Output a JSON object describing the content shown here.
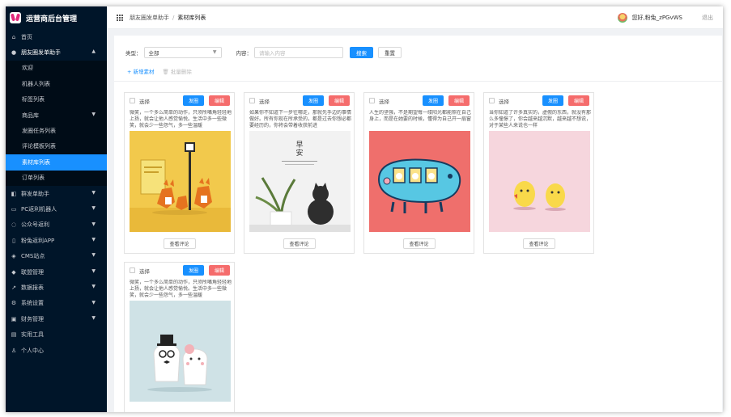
{
  "app": {
    "title": "运营商后台管理"
  },
  "sidebar": {
    "items": [
      {
        "label": "首页",
        "icon": "home-icon"
      },
      {
        "label": "朋友圈发单助手",
        "icon": "circle-icon",
        "open": true,
        "children": [
          {
            "label": "欢迎"
          },
          {
            "label": "机器人列表"
          },
          {
            "label": "标签列表"
          },
          {
            "label": "商品库",
            "has_children": true
          },
          {
            "label": "发圈任务列表"
          },
          {
            "label": "评论模板列表"
          },
          {
            "label": "素材库列表",
            "active": true
          },
          {
            "label": "订单列表"
          }
        ]
      },
      {
        "label": "群发单助手",
        "icon": "group-icon"
      },
      {
        "label": "PC返利机器人",
        "icon": "pc-icon"
      },
      {
        "label": "公众号返利",
        "icon": "wechat-icon"
      },
      {
        "label": "粉兔返利APP",
        "icon": "phone-icon"
      },
      {
        "label": "CMS站点",
        "icon": "cms-icon"
      },
      {
        "label": "联盟管理",
        "icon": "alliance-icon"
      },
      {
        "label": "数据报表",
        "icon": "chart-icon"
      },
      {
        "label": "系统设置",
        "icon": "gear-icon"
      },
      {
        "label": "财务管理",
        "icon": "finance-icon"
      },
      {
        "label": "实用工具",
        "icon": "tool-icon"
      },
      {
        "label": "个人中心",
        "icon": "user-icon"
      }
    ]
  },
  "header": {
    "breadcrumb": [
      "朋友圈发单助手",
      "素材库列表"
    ],
    "greeting": "您好,粉兔_zPGvWS",
    "logout": "退出"
  },
  "filter": {
    "type_label": "类型：",
    "type_value": "全部",
    "content_label": "内容：",
    "content_placeholder": "请输入内容",
    "search_label": "搜索",
    "reset_label": "重置"
  },
  "actions": {
    "add_label": "+ 新增素材",
    "delete_label": "批量删除"
  },
  "cards": [
    {
      "select_label": "选择",
      "send_label": "发圈",
      "edit_label": "编辑",
      "desc": "微笑，一个多么简单的动作，只须所嘴角轻轻地上扬，就会让他人感觉愉悦。生活中多一些微笑，就会少一些怨气，多一些温暖",
      "view_label": "查看评论",
      "image": "foxes"
    },
    {
      "select_label": "选择",
      "send_label": "发圈",
      "edit_label": "编辑",
      "desc": "如果你不知道下一步往哪走，那就先手边的事情做好。所有你现在所承受的，都是过去你想必都要经历的，你将会带着收获前进",
      "view_label": "查看评论",
      "image": "plant",
      "image_text": [
        "早",
        "安"
      ]
    },
    {
      "select_label": "选择",
      "send_label": "发圈",
      "edit_label": "编辑",
      "desc": "人生的坚强，不是期望每一缕阳光都能照在自己身上，而是在她要的时候，懂得为自己开一扇窗",
      "view_label": "查看评论",
      "image": "bus"
    },
    {
      "select_label": "选择",
      "send_label": "发圈",
      "edit_label": "编辑",
      "desc": "当你知道了许多真实的，虚假的东西，就没有那么多憧憬了，你会越来越沉默，越来越不想说，对于某些人来说也一样",
      "view_label": "查看评论",
      "image": "chicks"
    },
    {
      "select_label": "选择",
      "send_label": "发圈",
      "edit_label": "编辑",
      "desc": "微笑，一个多么简单的动作，只须所嘴角轻轻地上扬，就会让他人感觉愉悦。生活中多一些微笑，就会少一些怨气，多一些温暖",
      "view_label": "查看评论",
      "image": "couple"
    }
  ],
  "colors": {
    "sidebar": "#001529",
    "accent": "#1890ff",
    "danger": "#f56c6c"
  }
}
